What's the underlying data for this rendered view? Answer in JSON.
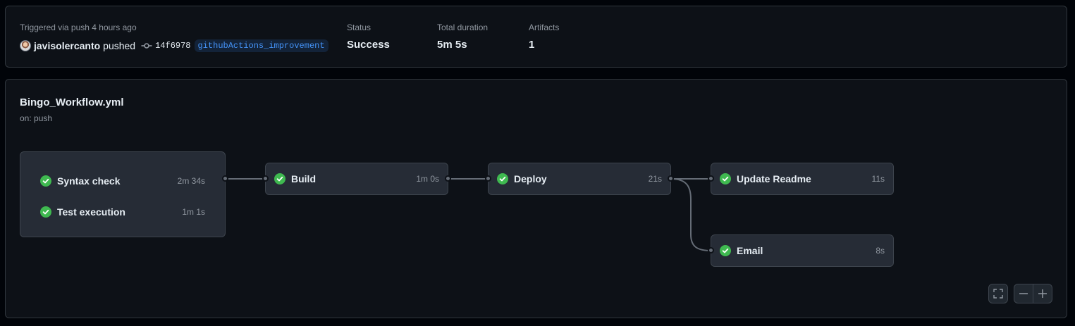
{
  "summary": {
    "triggered_text": "Triggered via push 4 hours ago",
    "actor": "javisolercanto",
    "action": "pushed",
    "commit_sha": "14f6978",
    "branch": "githubActions_improvement",
    "status_label": "Status",
    "status_value": "Success",
    "duration_label": "Total duration",
    "duration_value": "5m 5s",
    "artifacts_label": "Artifacts",
    "artifacts_value": "1"
  },
  "workflow": {
    "name": "Bingo_Workflow.yml",
    "trigger": "on: push"
  },
  "jobs": {
    "syntax_check": {
      "name": "Syntax check",
      "duration": "2m 34s",
      "status": "success"
    },
    "test_execution": {
      "name": "Test execution",
      "duration": "1m 1s",
      "status": "success"
    },
    "build": {
      "name": "Build",
      "duration": "1m 0s",
      "status": "success"
    },
    "deploy": {
      "name": "Deploy",
      "duration": "21s",
      "status": "success"
    },
    "update_readme": {
      "name": "Update Readme",
      "duration": "11s",
      "status": "success"
    },
    "email": {
      "name": "Email",
      "duration": "8s",
      "status": "success"
    }
  },
  "controls": {
    "fullscreen_icon": "fullscreen-icon",
    "zoom_out_icon": "minus-icon",
    "zoom_in_icon": "plus-icon"
  },
  "colors": {
    "success": "#3fb950",
    "accent": "#4493f8",
    "background": "#0d1117"
  }
}
